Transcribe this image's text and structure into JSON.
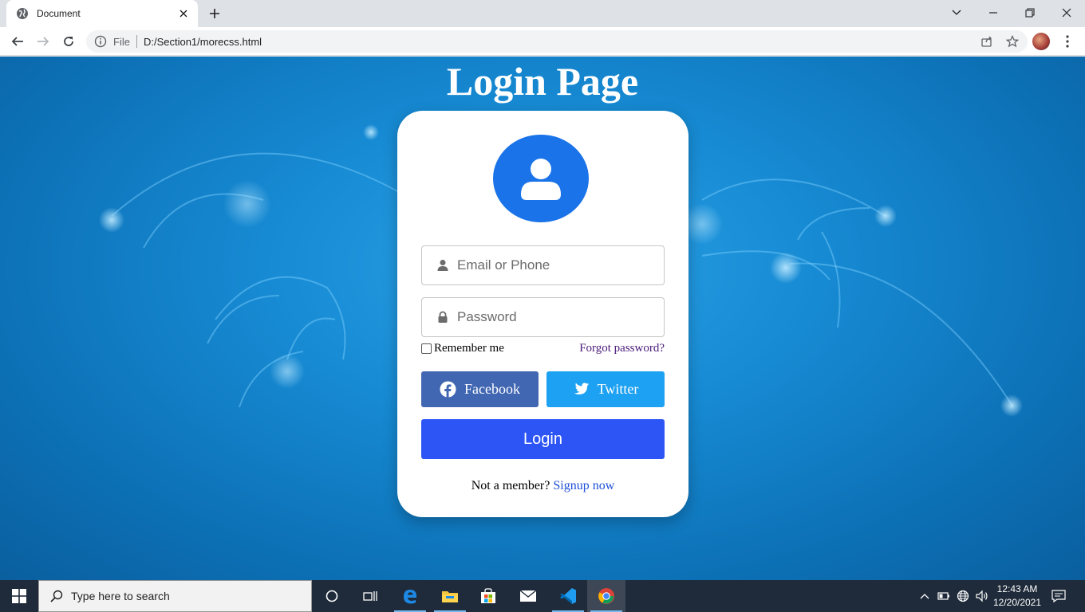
{
  "browser": {
    "tab_title": "Document",
    "url_scheme_label": "File",
    "url": "D:/Section1/morecss.html"
  },
  "page": {
    "title": "Login Page",
    "email_placeholder": "Email or Phone",
    "password_placeholder": "Password",
    "remember_label": "Remember me",
    "forgot_label": "Forgot password?",
    "facebook_label": "Facebook",
    "twitter_label": "Twitter",
    "login_label": "Login",
    "signup_prompt": "Not a member?",
    "signup_link": "Signup now"
  },
  "taskbar": {
    "search_placeholder": "Type here to search",
    "time": "12:43 AM",
    "date": "12/20/2021"
  },
  "colors": {
    "card_bg": "#ffffff",
    "avatar_bg": "#1a73e8",
    "facebook": "#4267b2",
    "twitter": "#1da1f2",
    "login": "#2d55f5",
    "page_bg": "#178bd4"
  }
}
